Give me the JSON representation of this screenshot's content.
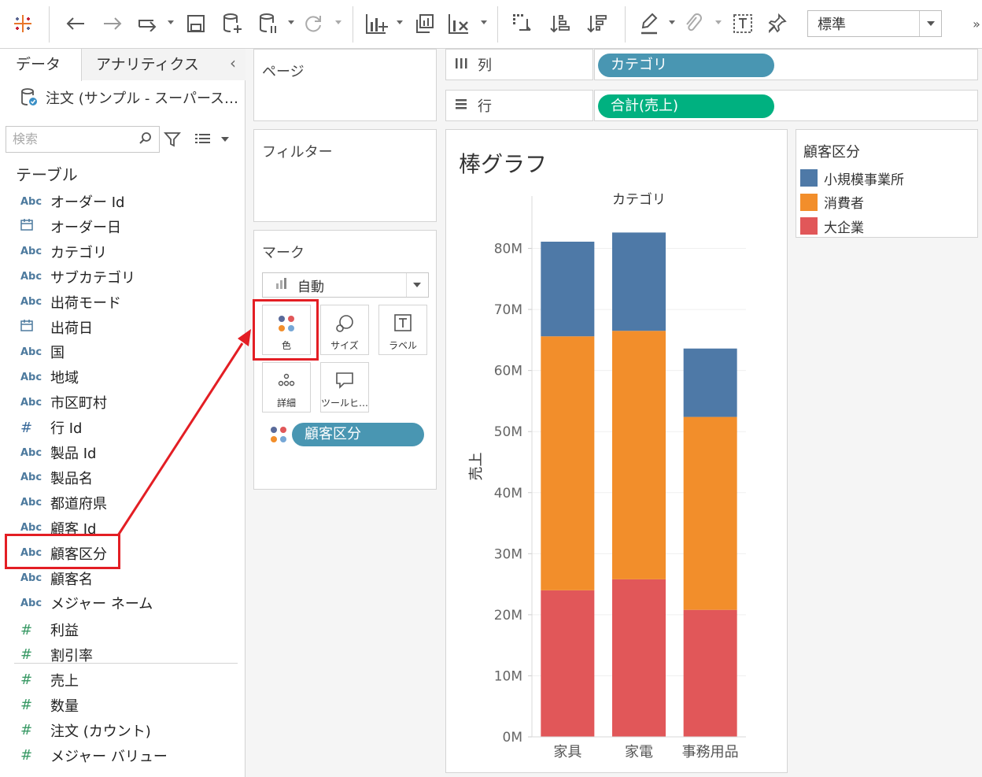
{
  "toolbar": {
    "zoom_value": "標準"
  },
  "data_pane": {
    "tab_data": "データ",
    "tab_analytics": "アナリティクス",
    "collapse": "‹",
    "datasource": "注文 (サンプル - スーパース…",
    "search_placeholder": "検索",
    "section": "テーブル",
    "dimensions": [
      {
        "type": "Abc",
        "name": "オーダー Id"
      },
      {
        "type": "date",
        "name": "オーダー日"
      },
      {
        "type": "Abc",
        "name": "カテゴリ"
      },
      {
        "type": "Abc",
        "name": "サブカテゴリ"
      },
      {
        "type": "Abc",
        "name": "出荷モード"
      },
      {
        "type": "date",
        "name": "出荷日"
      },
      {
        "type": "Abc",
        "name": "国"
      },
      {
        "type": "Abc",
        "name": "地域"
      },
      {
        "type": "Abc",
        "name": "市区町村"
      },
      {
        "type": "#",
        "name": "行 Id"
      },
      {
        "type": "Abc",
        "name": "製品 Id"
      },
      {
        "type": "Abc",
        "name": "製品名"
      },
      {
        "type": "Abc",
        "name": "都道府県"
      },
      {
        "type": "Abc",
        "name": "顧客 Id"
      },
      {
        "type": "Abc",
        "name": "顧客区分"
      },
      {
        "type": "Abc",
        "name": "顧客名"
      },
      {
        "type": "Abc",
        "name": "メジャー ネーム"
      }
    ],
    "measures": [
      {
        "type": "#",
        "name": "利益"
      },
      {
        "type": "#",
        "name": "割引率"
      },
      {
        "type": "#",
        "name": "売上"
      },
      {
        "type": "#",
        "name": "数量"
      },
      {
        "type": "#",
        "name": "注文 (カウント)"
      },
      {
        "type": "#",
        "name": "メジャー バリュー"
      }
    ]
  },
  "pages_card": {
    "title": "ページ"
  },
  "filters_card": {
    "title": "フィルター"
  },
  "marks_card": {
    "title": "マーク",
    "mark_type": "自動",
    "buttons": {
      "color": "色",
      "size": "サイズ",
      "label": "ラベル",
      "detail": "詳細",
      "tooltip": "ツールヒ…"
    },
    "color_pill": "顧客区分"
  },
  "shelves": {
    "columns_label": "列",
    "columns_pill": "カテゴリ",
    "rows_label": "行",
    "rows_pill": "合計(売上)"
  },
  "view": {
    "title": "棒グラフ"
  },
  "legend": {
    "title": "顧客区分",
    "items": [
      {
        "label": "小規模事業所",
        "color": "#4e79a7"
      },
      {
        "label": "消費者",
        "color": "#f28e2b"
      },
      {
        "label": "大企業",
        "color": "#e15759"
      }
    ]
  },
  "colors": {
    "dimension_pill": "#4996b2",
    "measure_pill": "#00b180",
    "highlight": "#e31e24"
  },
  "chart_data": {
    "type": "bar",
    "stacked": true,
    "title": "カテゴリ",
    "xlabel": "",
    "ylabel": "売上",
    "categories": [
      "家具",
      "家電",
      "事務用品"
    ],
    "series": [
      {
        "name": "大企業",
        "color": "#e15759",
        "values": [
          24.0,
          25.8,
          20.8
        ]
      },
      {
        "name": "消費者",
        "color": "#f28e2b",
        "values": [
          41.6,
          40.7,
          31.6
        ]
      },
      {
        "name": "小規模事業所",
        "color": "#4e79a7",
        "values": [
          15.5,
          16.1,
          11.2
        ]
      }
    ],
    "ylim": [
      0,
      86
    ],
    "yticks": [
      0,
      10,
      20,
      30,
      40,
      50,
      60,
      70,
      80
    ],
    "ytick_labels": [
      "0M",
      "10M",
      "20M",
      "30M",
      "40M",
      "50M",
      "60M",
      "70M",
      "80M"
    ],
    "unit": "M",
    "grid": true
  }
}
